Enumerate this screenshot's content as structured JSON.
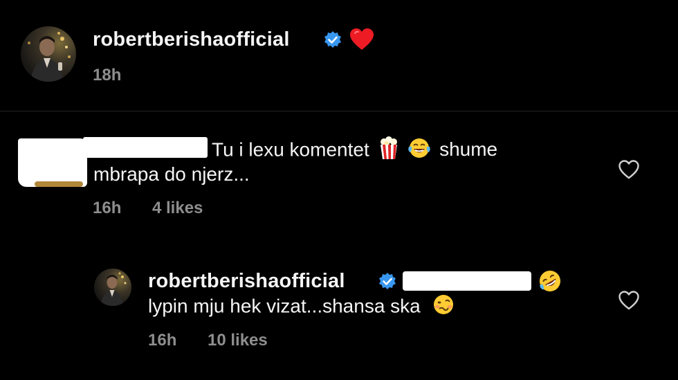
{
  "post": {
    "username": "robertberishaofficial",
    "verified_icon": "verified-badge-icon",
    "heart_emoji": "❤",
    "time": "18h"
  },
  "comment": {
    "text_line1_before": "Tu i lexu komentet",
    "text_line1_after": "shume",
    "text_line2": "mbrapa do njerz...",
    "emoji1": "popcorn-emoji",
    "emoji2": "face-with-tears-of-joy-emoji",
    "time": "16h",
    "likes": "4 likes",
    "like_icon": "heart-outline-icon"
  },
  "reply": {
    "username": "robertberishaofficial",
    "verified_icon": "verified-badge-icon",
    "emoji_after_mention": "rolling-on-floor-laughing-emoji",
    "text": "lypin mju hek vizat...shansa ska",
    "emoji_end": "woozy-face-emoji",
    "time": "16h",
    "likes": "10 likes",
    "like_icon": "heart-outline-icon"
  },
  "colors": {
    "background": "#000000",
    "text": "#f5f5f5",
    "secondary": "#8e8e8e",
    "verified": "#3897f0",
    "heart": "#ed1c24"
  }
}
